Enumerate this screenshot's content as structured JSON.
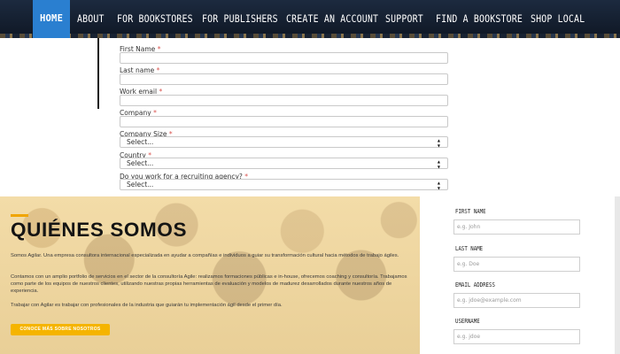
{
  "nav": {
    "items": [
      "HOME",
      "ABOUT",
      "FOR BOOKSTORES",
      "FOR PUBLISHERS",
      "CREATE AN ACCOUNT",
      "SUPPORT",
      "FIND A BOOKSTORE",
      "SHOP LOCAL"
    ],
    "active_item": "HOME"
  },
  "form": {
    "first_name_label": "First Name",
    "last_name_label": "Last name",
    "work_email_label": "Work email",
    "company_label": "Company",
    "company_size_label": "Company Size",
    "company_size_value": "Select...",
    "country_label": "Country",
    "country_value": "Select...",
    "recruiting_label": "Do you work for a recruiting agency?",
    "recruiting_value": "Select...",
    "required_marker": "*"
  },
  "about": {
    "heading": "QUIÉNES SOMOS",
    "para1": "Somos Agilar. Una empresa consultora internacional especializada en ayudar a compañías e individuos a guiar su transformación cultural hacia métodos de trabajo ágiles.",
    "para2": "Contamos con un amplio portfolio de servicios en el sector de la consultoría Agile: realizamos formaciones públicas e in-house, ofrecemos coaching y consultoría. Trabajamos como parte de los equipos de nuestros clientes, utilizando nuestras propias herramientas de evaluación y modelos de madurez desarrollados durante nuestros años de experiencia.",
    "para3": "Trabajar con Agilar es trabajar con profesionales de la industria que guiarán tu implementación ágil desde el primer día.",
    "cta_label": "CONOCE MÁS SOBRE NOSOTROS"
  },
  "registration": {
    "first_name_label": "FIRST NAME",
    "first_name_placeholder": "e.g. John",
    "last_name_label": "LAST NAME",
    "last_name_placeholder": "e.g. Doe",
    "email_label": "EMAIL ADDRESS",
    "email_placeholder": "e.g. jdoe@example.com",
    "username_label": "USERNAME",
    "username_placeholder": "e.g. jdoe"
  },
  "colors": {
    "nav_active": "#2a7fd0",
    "nav_background": "#1c2a3f",
    "accent": "#f5b400",
    "required": "#d9534f"
  }
}
